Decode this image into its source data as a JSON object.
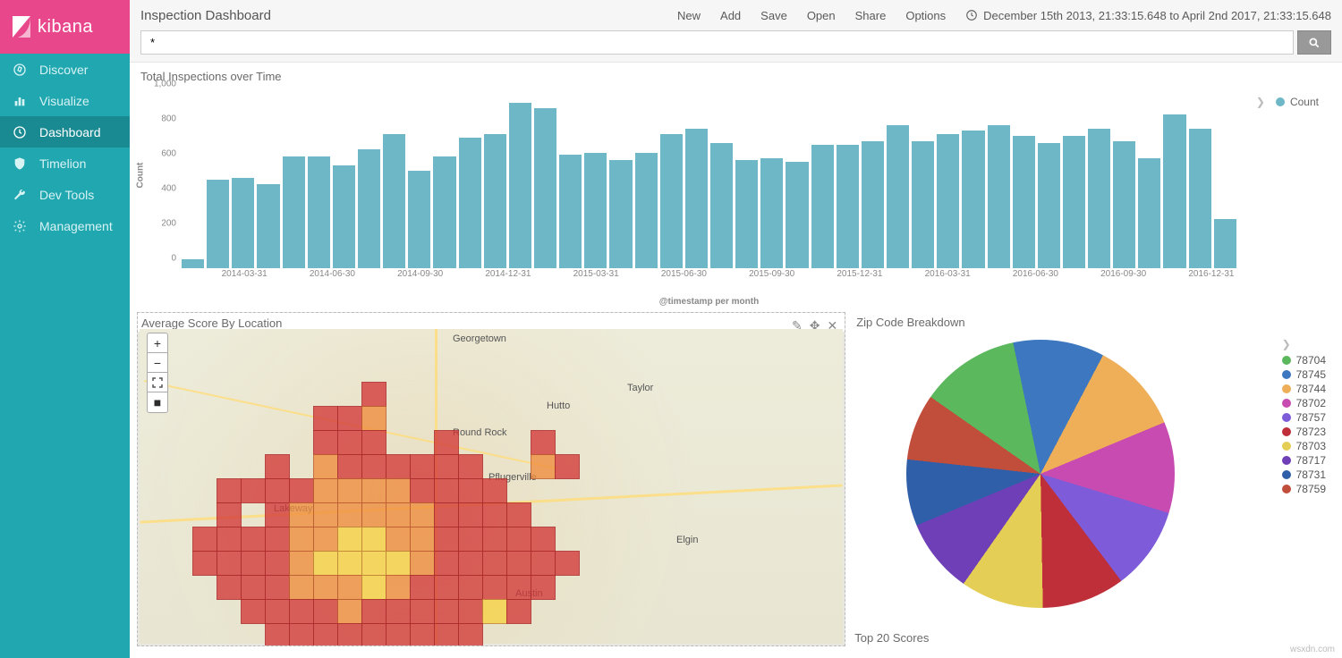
{
  "app": {
    "logo_text": "kibana"
  },
  "nav": [
    {
      "label": "Discover",
      "icon": "compass-icon"
    },
    {
      "label": "Visualize",
      "icon": "barchart-icon"
    },
    {
      "label": "Dashboard",
      "icon": "clock-icon",
      "active": true
    },
    {
      "label": "Timelion",
      "icon": "shield-icon"
    },
    {
      "label": "Dev Tools",
      "icon": "wrench-icon"
    },
    {
      "label": "Management",
      "icon": "gear-icon"
    }
  ],
  "header": {
    "title": "Inspection Dashboard",
    "menu": [
      "New",
      "Add",
      "Save",
      "Open",
      "Share",
      "Options"
    ],
    "time_range": "December 15th 2013, 21:33:15.648 to April 2nd 2017, 21:33:15.648"
  },
  "search": {
    "query": "*"
  },
  "panels": {
    "bar": {
      "title": "Total Inspections over Time",
      "legend": "Count"
    },
    "map": {
      "title": "Average Score By Location",
      "cities": [
        "Georgetown",
        "Taylor",
        "Hutto",
        "Round Rock",
        "Pflugerville",
        "Elgin",
        "Austin",
        "Lakeway"
      ]
    },
    "pie": {
      "title": "Zip Code Breakdown"
    },
    "top": {
      "title": "Top 20 Scores"
    }
  },
  "watermark": "wsxdn.com",
  "chart_data": [
    {
      "id": "total-inspections",
      "type": "bar",
      "title": "Total Inspections over Time",
      "xlabel": "@timestamp per month",
      "ylabel": "Count",
      "ylim": [
        0,
        1000
      ],
      "yticks": [
        0,
        200,
        400,
        600,
        800,
        "1,000"
      ],
      "xticks": [
        "2014-03-31",
        "2014-06-30",
        "2014-09-30",
        "2014-12-31",
        "2015-03-31",
        "2015-06-30",
        "2015-09-30",
        "2015-12-31",
        "2016-03-31",
        "2016-06-30",
        "2016-09-30",
        "2016-12-31"
      ],
      "series": [
        {
          "name": "Count",
          "color": "#6DB7C6",
          "values": [
            50,
            510,
            520,
            480,
            640,
            640,
            590,
            680,
            770,
            560,
            640,
            750,
            770,
            950,
            920,
            650,
            660,
            620,
            660,
            770,
            800,
            720,
            620,
            630,
            610,
            710,
            710,
            730,
            820,
            730,
            770,
            790,
            820,
            760,
            720,
            760,
            800,
            730,
            630,
            880,
            800,
            280
          ]
        }
      ]
    },
    {
      "id": "zip-pie",
      "type": "pie",
      "title": "Zip Code Breakdown",
      "series": [
        {
          "name": "78704",
          "value": 12,
          "color": "#5BB85D"
        },
        {
          "name": "78745",
          "value": 11,
          "color": "#3C77C0"
        },
        {
          "name": "78744",
          "value": 11,
          "color": "#EFAE58"
        },
        {
          "name": "78702",
          "value": 11,
          "color": "#C74BB0"
        },
        {
          "name": "78757",
          "value": 10,
          "color": "#7D5BD9"
        },
        {
          "name": "78723",
          "value": 10,
          "color": "#BE2F3A"
        },
        {
          "name": "78703",
          "value": 10,
          "color": "#E4CE55"
        },
        {
          "name": "78717",
          "value": 9,
          "color": "#6F3FB8"
        },
        {
          "name": "78731",
          "value": 8,
          "color": "#2F5FA8"
        },
        {
          "name": "78759",
          "value": 8,
          "color": "#C14E3B"
        }
      ]
    }
  ]
}
